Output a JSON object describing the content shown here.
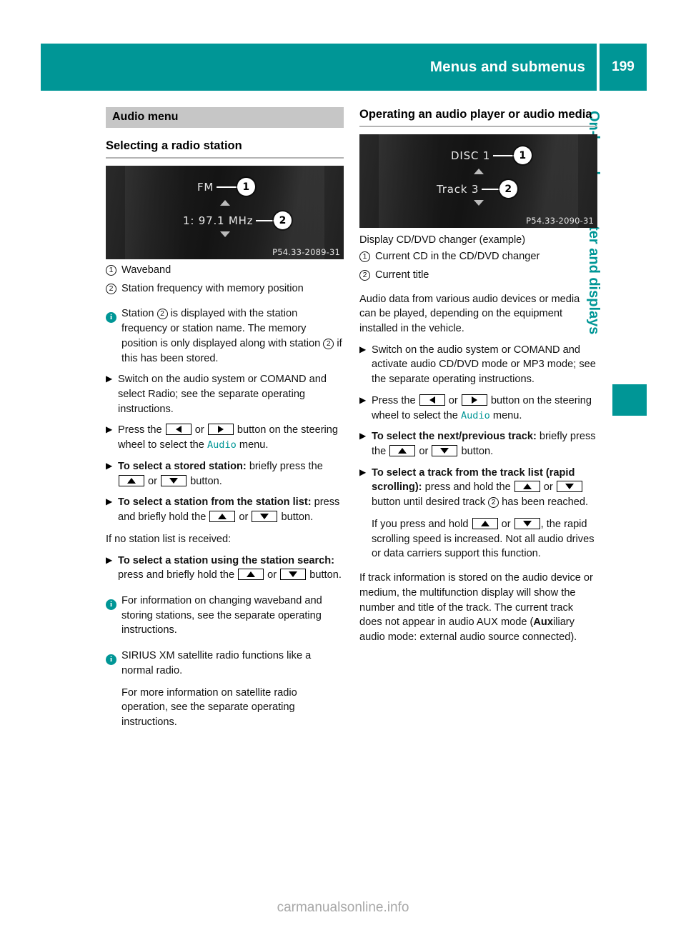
{
  "header": {
    "title": "Menus and submenus",
    "page_number": "199"
  },
  "side_tab": {
    "label": "On-board computer and displays",
    "accent_color": "#009696"
  },
  "left_column": {
    "section_title": "Audio menu",
    "subheading": "Selecting a radio station",
    "display": {
      "line1": "FM",
      "line2": "1: 97.1 MHz",
      "marker1": "1",
      "marker2": "2",
      "image_code": "P54.33-2089-31"
    },
    "legend": [
      {
        "mark": "1",
        "text": "Waveband"
      },
      {
        "mark": "2",
        "text": "Station frequency with memory position"
      }
    ],
    "note_1_pre": "Station ",
    "note_1_mid": " is displayed with the station frequency or station name. The memory position is only displayed along with station ",
    "note_1_post": " if this has been stored.",
    "step_1": "Switch on the audio system or COMAND and select Radio; see the separate operating instructions.",
    "step_2_pre": "Press the ",
    "step_2_mid": " or ",
    "step_2_post": " button on the steering wheel to select the ",
    "step_2_keyword": "Audio",
    "step_2_end": " menu.",
    "step_3_bold": "To select a stored station:",
    "step_3_pre": " briefly press the ",
    "step_3_mid": " or ",
    "step_3_post": " button.",
    "step_4_bold": "To select a station from the station list:",
    "step_4_pre": " press and briefly hold the ",
    "step_4_mid": " or ",
    "step_4_post": " button.",
    "intertext": "If no station list is received:",
    "step_5_bold": "To select a station using the station search:",
    "step_5_pre": " press and briefly hold the ",
    "step_5_mid": " or ",
    "step_5_post": " button.",
    "note_2": "For information on changing waveband and storing stations, see the separate operating instructions.",
    "note_3": "SIRIUS XM satellite radio functions like a normal radio.",
    "note_3_para": "For more information on satellite radio operation, see the separate operating instructions."
  },
  "right_column": {
    "subheading": "Operating an audio player or audio media",
    "display": {
      "line1": "DISC 1",
      "line2": "Track 3",
      "marker1": "1",
      "marker2": "2",
      "image_code": "P54.33-2090-31"
    },
    "image_caption": "Display CD/DVD changer (example)",
    "legend": [
      {
        "mark": "1",
        "text": "Current CD in the CD/DVD changer"
      },
      {
        "mark": "2",
        "text": "Current title"
      }
    ],
    "para_1": "Audio data from various audio devices or media can be played, depending on the equipment installed in the vehicle.",
    "step_1": "Switch on the audio system or COMAND and activate audio CD/DVD mode or MP3 mode; see the separate operating instructions.",
    "step_2_pre": "Press the ",
    "step_2_mid": " or ",
    "step_2_post": " button on the steering wheel to select the ",
    "step_2_keyword": "Audio",
    "step_2_end": " menu.",
    "step_3_bold": "To select the next/previous track:",
    "step_3_pre": " briefly press the ",
    "step_3_mid": " or ",
    "step_3_post": " button.",
    "step_4_bold_a": "To select a track from the track list (rapid scrolling):",
    "step_4_pre": " press and hold the ",
    "step_4_mid": " or ",
    "step_4_post": " button until desired track ",
    "step_4_end": " has been reached.",
    "step_4_sub_pre": "If you press and hold ",
    "step_4_sub_mid": " or ",
    "step_4_sub_post": ", the rapid scrolling speed is increased. Not all audio drives or data carriers support this function.",
    "para_2_a": "If track information is stored on the audio device or medium, the multifunction display will show the number and title of the track. The current track does not appear in audio AUX mode (",
    "para_2_bold": "Aux",
    "para_2_b": "iliary audio mode: external audio source connected)."
  },
  "watermark": "carmanualsonline.info"
}
